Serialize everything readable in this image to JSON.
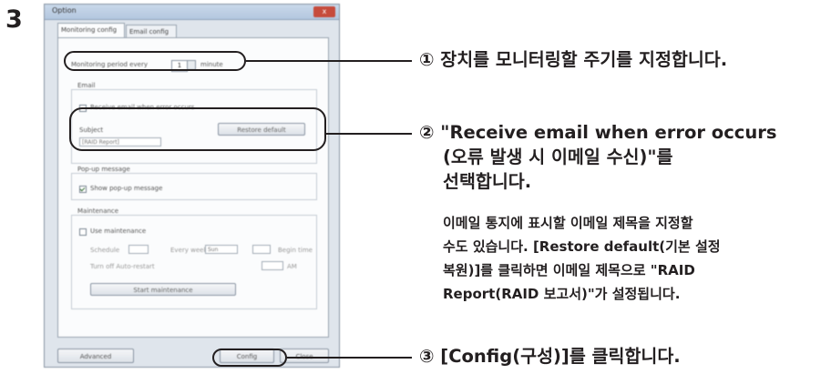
{
  "step_number": "3",
  "dialog": {
    "title": "Option",
    "close_label": "x",
    "tabs": [
      "Monitoring config",
      "Email config"
    ],
    "monitoring_label": "Monitoring period every",
    "monitoring_value": "1",
    "monitoring_unit": "minute",
    "email_group": "Email",
    "receive_email_label": "Receive email when error occurs",
    "subject_label": "Subject",
    "subject_value": "[RAID Report]",
    "restore_default_label": "Restore default",
    "popup_group": "Pop-up message",
    "show_popup_label": "Show pop-up message",
    "maintenance_group": "Maintenance",
    "use_maintenance_label": "Use maintenance",
    "schedule_label": "Schedule",
    "every_week_label": "Every week",
    "sun_value": "Sun",
    "begin_time_label": "Begin time",
    "turn_off_label": "Turn off Auto-restart",
    "at_label": "AM",
    "start_maintenance_label": "Start maintenance",
    "advanced_label": "Advanced",
    "config_label": "Config",
    "close_button_label": "Close"
  },
  "callouts": {
    "c1": "① 장치를 모니터링할 주기를 지정합니다.",
    "c2_line1": "② \"Receive email when error occurs",
    "c2_line2": "(오류 발생 시 이메일 수신)\"를",
    "c2_line3": "선택합니다.",
    "desc_line1": "이메일 통지에 표시할 이메일 제목을 지정할",
    "desc_line2": "수도 있습니다. [Restore default(기본 설정",
    "desc_line3": "복원)]를 클릭하면 이메일 제목으로 \"RAID",
    "desc_line4": "Report(RAID 보고서)\"가 설정됩니다.",
    "c3": "③ [Config(구성)]를 클릭합니다."
  }
}
